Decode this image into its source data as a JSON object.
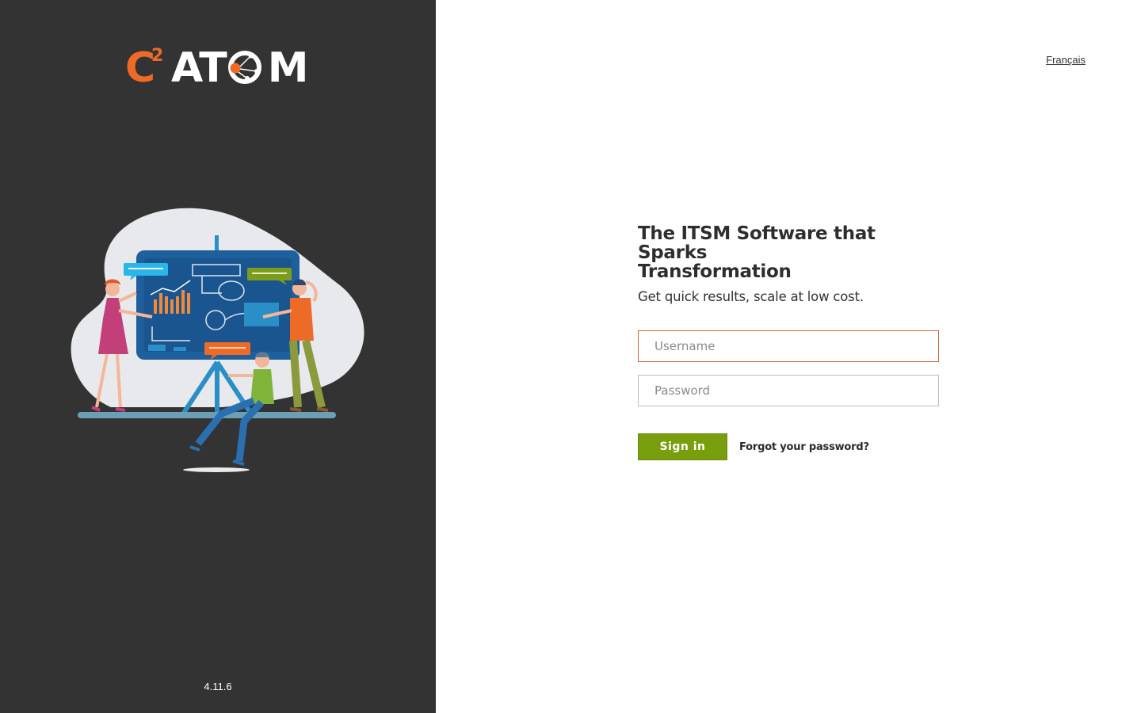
{
  "brand": {
    "logo_c": "C",
    "logo_sup": "2",
    "logo_atom_start": "AT",
    "logo_atom_end": "M",
    "accent_color": "#ee6a27"
  },
  "sidebar": {
    "illustration_icon": "presentation-team-illustration",
    "version": "4.11.6"
  },
  "header": {
    "language_link": "Français"
  },
  "login": {
    "title_line1": "The ITSM Software that Sparks",
    "title_line2": "Transformation",
    "subtitle": "Get quick results, scale at low cost.",
    "username_placeholder": "Username",
    "username_value": "",
    "password_placeholder": "Password",
    "password_value": "",
    "signin_label": "Sign in",
    "signin_color": "#789e0e",
    "forgot_label": "Forgot your password?"
  }
}
